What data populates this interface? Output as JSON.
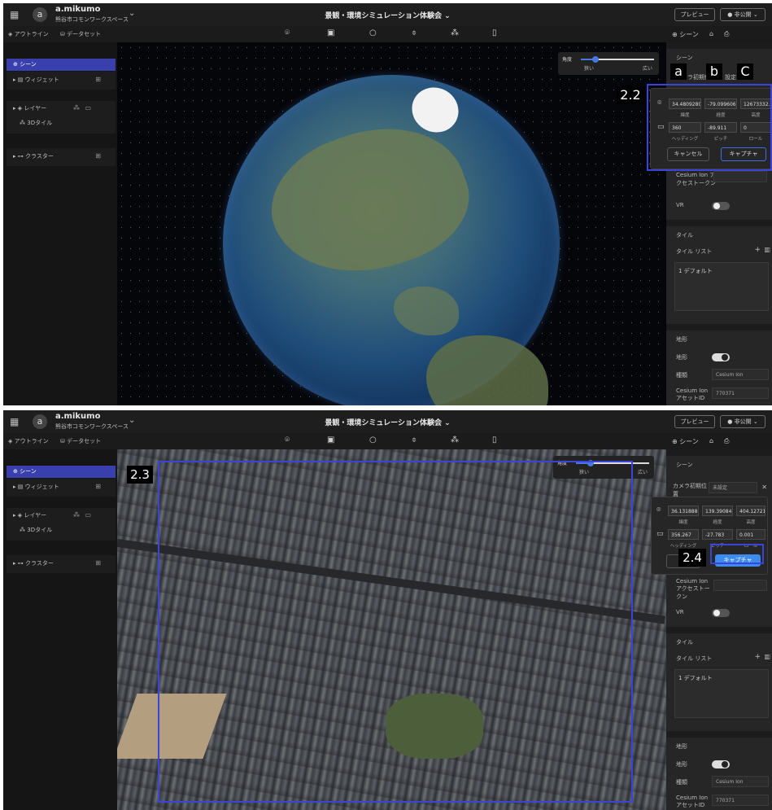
{
  "app": {
    "user_name": "a.mikumo",
    "avatar_letter": "a",
    "workspace": "熊谷市コモンワークスペース",
    "project_title": "景観・環境シミュレーション体験会",
    "preview_label": "プレビュー",
    "publish_label": "● 非公開 ⌄"
  },
  "left_tabs": {
    "outline": "アウトライン",
    "dataset": "データセット"
  },
  "outline": {
    "scene": "シーン",
    "widget": "ウィジェット",
    "layer": "レイヤー",
    "tiles_3d": "3Dタイル",
    "cluster": "クラスター"
  },
  "right_tabs": {
    "scene": "シーン"
  },
  "angle_control": {
    "label": "角度",
    "low": "狭い",
    "high": "広い",
    "value_fraction": 0.2
  },
  "shot1": {
    "panel": {
      "section_title": "シーン",
      "camera_initial": "カメラ初期位置",
      "partial_setting": "設定",
      "cesium_token_label": "Cesium Ion アクセストークン",
      "vr_label": "VR",
      "tile_section": "タイル",
      "tile_list": "タイル リスト",
      "tile_item": "1  デフォルト",
      "terrain_section": "地形",
      "terrain_label": "地形",
      "type_label": "種類",
      "type_value": "Cesium Ion",
      "asset_id_label": "Cesium Ion アセットID",
      "asset_id_value": "770371"
    },
    "popover": {
      "lat": "34.4809280",
      "lng": "-79.099606",
      "alt": "12673332.5",
      "lat_cap": "緯度",
      "lng_cap": "経度",
      "alt_cap": "高度",
      "heading": "360",
      "pitch": "-89.911",
      "roll": "0",
      "heading_cap": "ヘッディング",
      "pitch_cap": "ピッチ",
      "roll_cap": "ロール",
      "cancel": "キャンセル",
      "capture": "キャプチャ"
    },
    "annotations": {
      "a": "a",
      "b": "b",
      "c": "C",
      "step": "2.2"
    }
  },
  "shot2": {
    "panel": {
      "section_title": "シーン",
      "camera_initial": "カメラ初期位置",
      "camera_value": "未設定",
      "cesium_token_label": "Cesium Ion アクセストークン",
      "vr_label": "VR",
      "tile_section": "タイル",
      "tile_list": "タイル リスト",
      "tile_item": "1  デフォルト",
      "terrain_section": "地形",
      "terrain_label": "地形",
      "type_label": "種類",
      "type_value": "Cesium Ion",
      "asset_id_label": "Cesium Ion アセットID",
      "asset_id_value": "770371"
    },
    "popover": {
      "lat": "36.1318886",
      "lng": "139.390842",
      "alt": "404.127210",
      "lat_cap": "緯度",
      "lng_cap": "経度",
      "alt_cap": "高度",
      "heading": "356.267",
      "pitch": "-27.783",
      "roll": "0.001",
      "heading_cap": "ヘッディング",
      "pitch_cap": "ピッチ",
      "roll_cap": "ロール",
      "capture": "キャプチャ"
    },
    "annotations": {
      "step_view": "2.3",
      "step_capture": "2.4"
    }
  },
  "colors": {
    "accent": "#3a45d8",
    "selected": "#3a3fae",
    "capture_fill": "#3d8bf0"
  }
}
